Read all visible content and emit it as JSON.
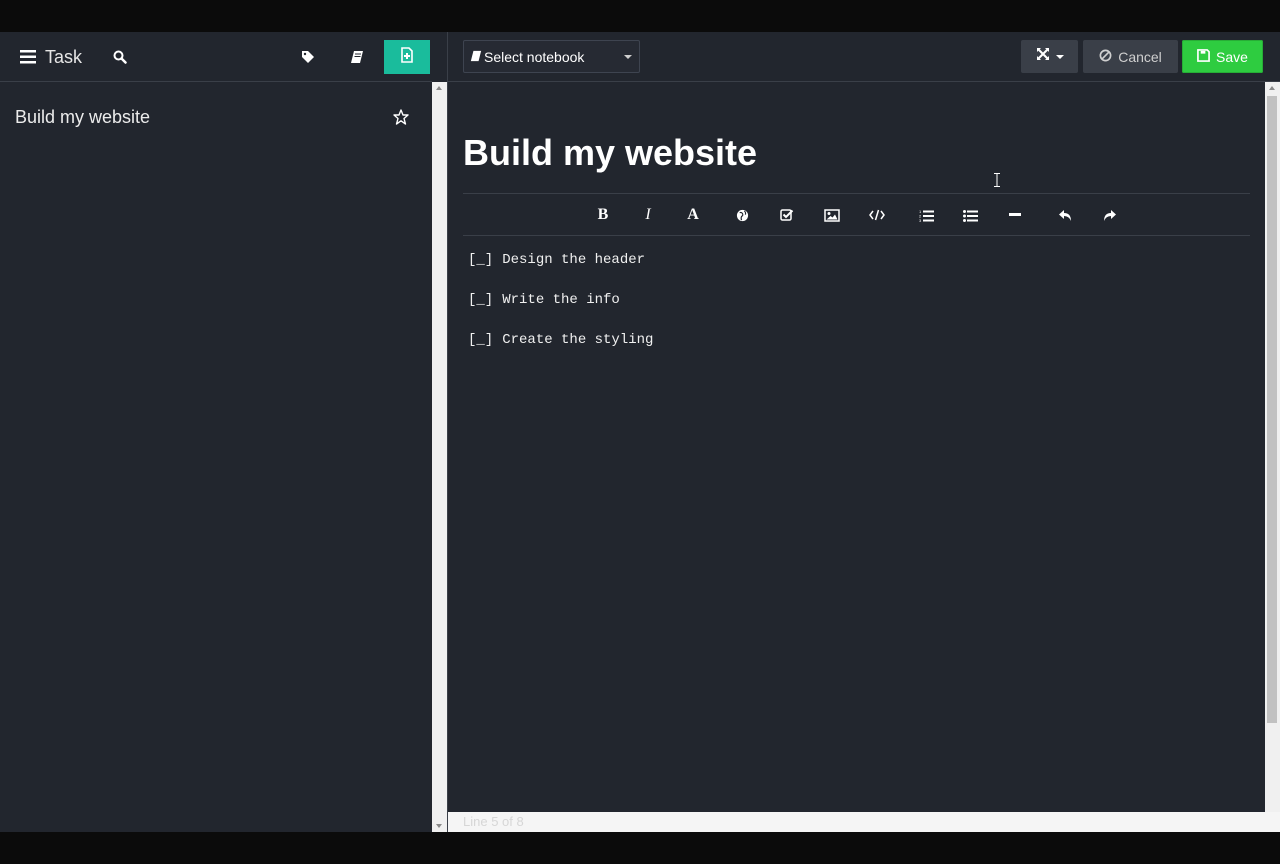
{
  "sidebar": {
    "app_title": "Task",
    "notes": [
      {
        "title": "Build my website"
      }
    ]
  },
  "editor": {
    "notebook_select": {
      "value": "Select notebook"
    },
    "cancel_label": "Cancel",
    "save_label": "Save",
    "doc_title": "Build my website",
    "toolbar": [
      "bold",
      "italic",
      "heading",
      "link",
      "checkbox",
      "image",
      "code",
      "ordered-list",
      "unordered-list",
      "horizontal-rule",
      "undo",
      "redo"
    ],
    "tasks": [
      {
        "box": "[_]",
        "text": "Design the header"
      },
      {
        "box": "[_]",
        "text": "Write the info"
      },
      {
        "box": "[_]",
        "text": "Create the styling"
      }
    ]
  },
  "statusbar": {
    "text": "Line 5 of 8"
  },
  "colors": {
    "background": "#22262e",
    "accent_new": "#1abc9c",
    "save": "#2ecc40",
    "button_dark": "#3a3f48"
  }
}
